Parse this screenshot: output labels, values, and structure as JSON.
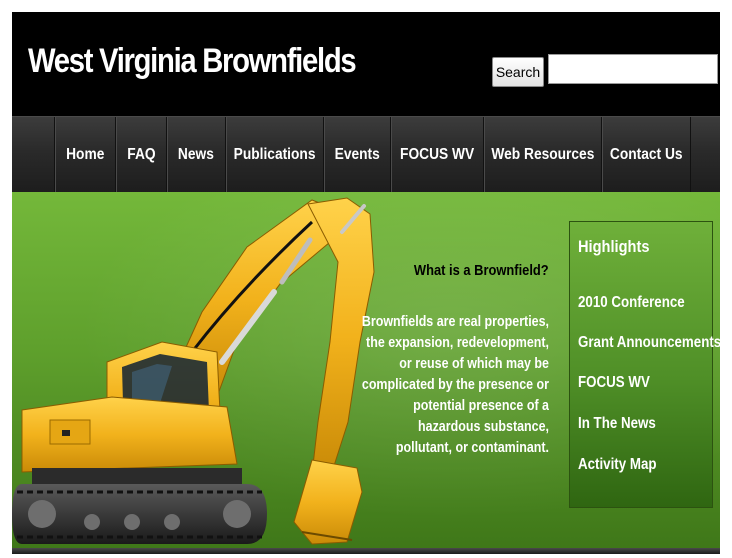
{
  "header": {
    "site_title": "West Virginia Brownfields",
    "search_button_label": "Search",
    "search_input_value": ""
  },
  "nav": {
    "items": [
      {
        "label": "Home"
      },
      {
        "label": "FAQ"
      },
      {
        "label": "News"
      },
      {
        "label": "Publications"
      },
      {
        "label": "Events"
      },
      {
        "label": "FOCUS WV"
      },
      {
        "label": "Web Resources"
      },
      {
        "label": "Contact Us"
      }
    ]
  },
  "content": {
    "question": "What is a Brownfield?",
    "definition": "Brownfields are real properties, the expansion, redevelopment, or reuse of which may be complicated by the presence or potential presence of a hazardous substance, pollutant, or contaminant."
  },
  "highlights": {
    "heading": "Highlights",
    "links": [
      {
        "label": "2010 Conference"
      },
      {
        "label": "Grant Announcements"
      },
      {
        "label": "FOCUS WV"
      },
      {
        "label": "In The News"
      },
      {
        "label": "Activity Map"
      }
    ]
  },
  "colors": {
    "header_bg": "#000000",
    "nav_bg": "#2a2a2a",
    "content_green": "#5e9f2c",
    "excavator_yellow": "#f2b21c"
  },
  "icons": {
    "banner_image": "excavator-image"
  }
}
